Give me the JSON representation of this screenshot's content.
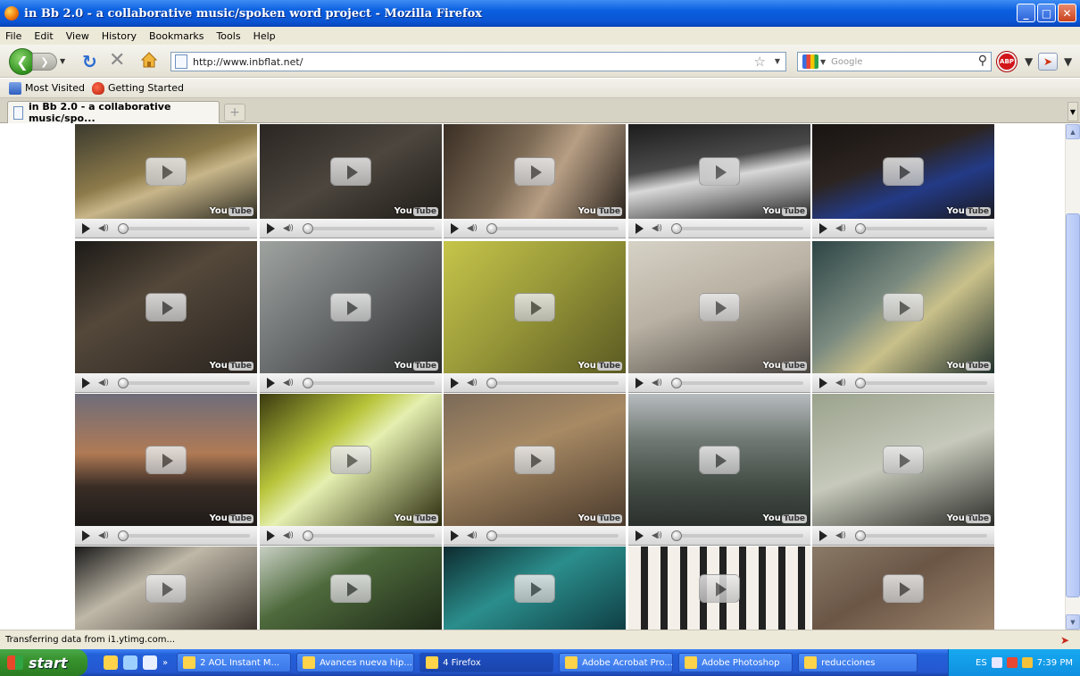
{
  "window": {
    "title": "in Bb 2.0 - a collaborative music/spoken word project - Mozilla Firefox",
    "min": "_",
    "max": "□",
    "close": "✕"
  },
  "menu": [
    "File",
    "Edit",
    "View",
    "History",
    "Bookmarks",
    "Tools",
    "Help"
  ],
  "nav": {
    "url": "http://www.inbflat.net/",
    "search_placeholder": "Google",
    "abp": "ABP"
  },
  "bookmarks": [
    "Most Visited",
    "Getting Started"
  ],
  "tab": {
    "label": "in Bb 2.0 - a collaborative music/spo..."
  },
  "videos": {
    "count": 20,
    "rows": 4,
    "cols": 5,
    "badge": "You",
    "badge_box": "Tube"
  },
  "status": {
    "text": "Transferring data from i1.ytimg.com..."
  },
  "taskbar": {
    "start": "start",
    "tasks": [
      {
        "label": "2 AOL Instant M...",
        "active": false
      },
      {
        "label": "Avances nueva hip...",
        "active": false
      },
      {
        "label": "4 Firefox",
        "active": true
      },
      {
        "label": "Adobe Acrobat Pro...",
        "active": false
      },
      {
        "label": "Adobe Photoshop",
        "active": false
      },
      {
        "label": "reducciones",
        "active": false
      }
    ],
    "tray_lang": "ES",
    "clock": "7:39 PM"
  }
}
